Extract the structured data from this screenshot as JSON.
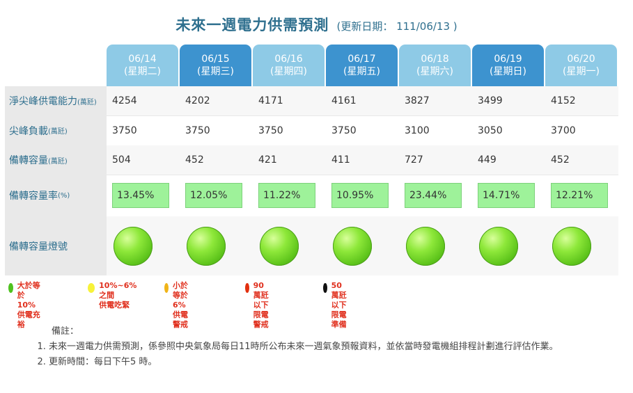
{
  "title": {
    "main": "未來一週電力供需預測",
    "sub": "(更新日期： 111/06/13 )"
  },
  "days": [
    {
      "date": "06/14",
      "weekday": "(星期二)",
      "tone": "light"
    },
    {
      "date": "06/15",
      "weekday": "(星期三)",
      "tone": "dark"
    },
    {
      "date": "06/16",
      "weekday": "(星期四)",
      "tone": "light"
    },
    {
      "date": "06/17",
      "weekday": "(星期五)",
      "tone": "dark"
    },
    {
      "date": "06/18",
      "weekday": "(星期六)",
      "tone": "light"
    },
    {
      "date": "06/19",
      "weekday": "(星期日)",
      "tone": "dark"
    },
    {
      "date": "06/20",
      "weekday": "(星期一)",
      "tone": "light"
    }
  ],
  "rows": {
    "capacity": {
      "label": "淨尖峰供電能力",
      "unit": "(萬瓩)",
      "values": [
        "4254",
        "4202",
        "4171",
        "4161",
        "3827",
        "3499",
        "4152"
      ]
    },
    "load": {
      "label": "尖峰負載",
      "unit": "(萬瓩)",
      "values": [
        "3750",
        "3750",
        "3750",
        "3750",
        "3100",
        "3050",
        "3700"
      ]
    },
    "reserve": {
      "label": "備轉容量",
      "unit": "(萬瓩)",
      "values": [
        "504",
        "452",
        "421",
        "411",
        "727",
        "449",
        "452"
      ]
    },
    "rate": {
      "label": "備轉容量率",
      "unit": "(%)",
      "values": [
        "13.45%",
        "12.05%",
        "11.22%",
        "10.95%",
        "23.44%",
        "14.71%",
        "12.21%"
      ]
    },
    "light": {
      "label": "備轉容量燈號",
      "status": [
        "green",
        "green",
        "green",
        "green",
        "green",
        "green",
        "green"
      ]
    }
  },
  "legend": [
    {
      "color": "#4fc21f",
      "line1": "大於等於10%",
      "line2": "供電充裕",
      "text_color": "#e0301e"
    },
    {
      "color": "#f7f23a",
      "line1": "10%~6% 之間",
      "line2": "供電吃緊",
      "text_color": "#e0301e"
    },
    {
      "color": "#f0b418",
      "line1": "小於等於6%",
      "line2": "供電警戒",
      "text_color": "#e0301e"
    },
    {
      "color": "#e2300f",
      "line1": "90萬瓩以下",
      "line2": "限電警戒",
      "text_color": "#e0301e"
    },
    {
      "color": "#111111",
      "line1": "50萬瓩以下",
      "line2": "限電準備",
      "text_color": "#e0301e"
    }
  ],
  "notes": {
    "heading": "備註：",
    "items": [
      "未來一週電力供需預測，係參照中央氣象局每日11時所公布未來一週氣象預報資料，並依當時發電機組排程計劃進行評估作業。",
      "更新時間：每日下午5 時。"
    ]
  }
}
